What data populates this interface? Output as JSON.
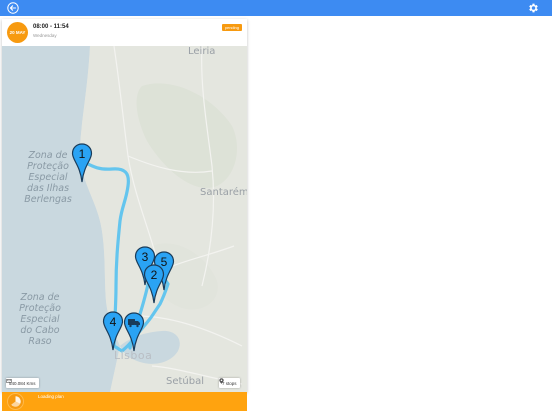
{
  "header": {
    "back_icon": "arrow-left-icon",
    "settings_icon": "gear-icon"
  },
  "colors": {
    "topbar": "#3d8bf2",
    "accent": "#f79a10",
    "route": "#55c1f0",
    "pin": "#2aa3f4"
  },
  "trip": {
    "badge": "20 MAY",
    "time": "08:00 - 11:54",
    "subtitle": "Wednesday",
    "status": "pending"
  },
  "map": {
    "places": {
      "leiria": "Leiria",
      "santarem": "Santarém",
      "lisboa": "Lisboa",
      "setubal": "Setúbal"
    },
    "zones": {
      "north_lines": [
        "Zona de",
        "Proteção",
        "Especial",
        "das Ilhas",
        "Berlengas"
      ],
      "south_lines": [
        "Zona de",
        "Proteção",
        "Especial",
        "do Cabo",
        "Raso"
      ]
    },
    "stops": [
      "1",
      "2",
      "3",
      "4",
      "5"
    ],
    "depot_icon": "truck-icon",
    "distance": "540.084 Kms",
    "stops_label": "7 stops"
  },
  "footer": {
    "label": "Loading plan"
  }
}
